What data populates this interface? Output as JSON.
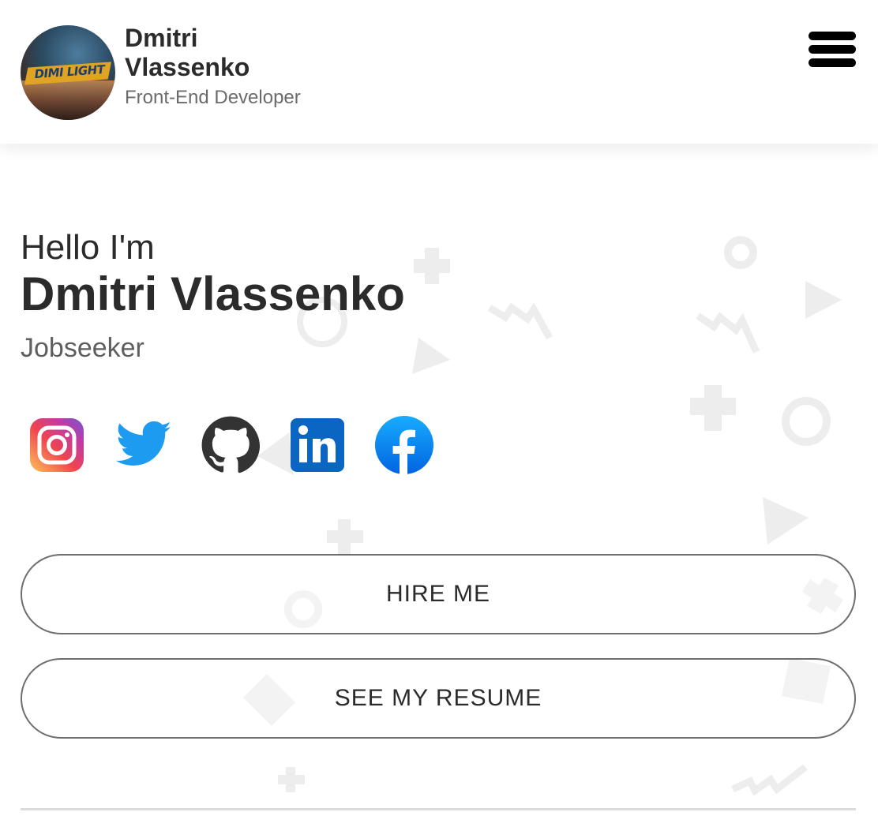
{
  "header": {
    "brand_name": "Dmitri Vlassenko",
    "brand_role": "Front-End Developer",
    "avatar_text": "DIMI LIGHT",
    "menu_icon": "hamburger-menu-icon"
  },
  "hero": {
    "greeting": "Hello I'm",
    "name": "Dmitri Vlassenko",
    "role": "Jobseeker"
  },
  "socials": [
    {
      "name": "instagram",
      "icon": "instagram-icon",
      "color": "#e1306c"
    },
    {
      "name": "twitter",
      "icon": "twitter-icon",
      "color": "#1d9bf0"
    },
    {
      "name": "github",
      "icon": "github-icon",
      "color": "#333333"
    },
    {
      "name": "linkedin",
      "icon": "linkedin-icon",
      "color": "#0a66c2"
    },
    {
      "name": "facebook",
      "icon": "facebook-icon",
      "color": "#1877f2"
    }
  ],
  "buttons": {
    "hire": "HIRE ME",
    "resume": "SEE MY RESUME"
  },
  "colors": {
    "text": "#2b2b2b",
    "muted": "#6b6b6b",
    "decor": "#eeeeee",
    "button_border": "#6e6e6e"
  }
}
